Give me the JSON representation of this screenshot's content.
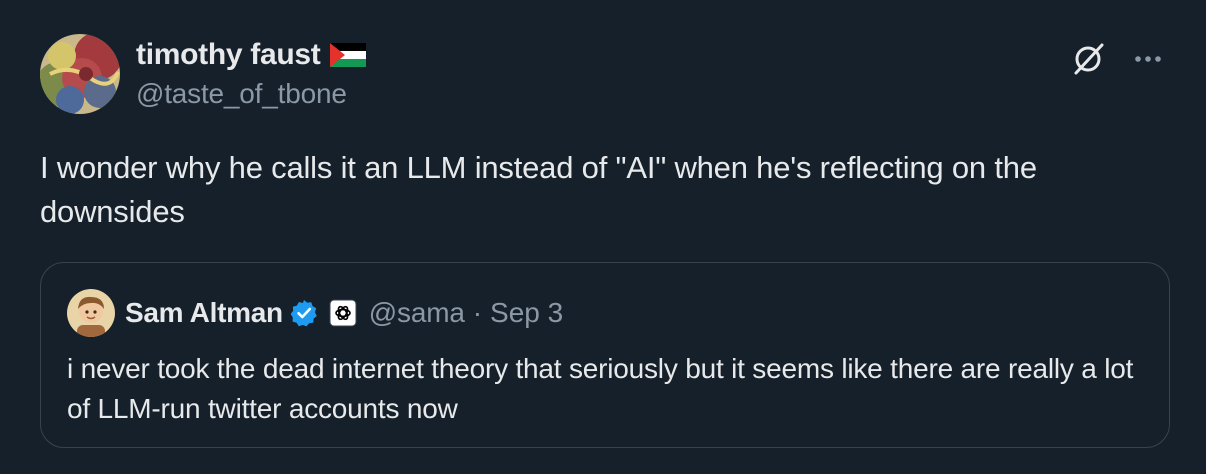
{
  "author": {
    "display_name": "timothy faust",
    "handle": "@taste_of_tbone",
    "flag_icon": "palestine-flag-icon"
  },
  "tweet": {
    "text": "I wonder why he calls it an LLM instead of \"AI\" when he's reflecting on the downsides"
  },
  "toolbar": {
    "grok_icon": "grok-icon",
    "more_icon": "more-options-icon"
  },
  "quoted_tweet": {
    "display_name": "Sam Altman",
    "handle": "@sama",
    "separator": "·",
    "date": "Sep 3",
    "text": "i never took the dead internet theory that seriously but it seems like there are really a lot of LLM-run twitter accounts now",
    "verified_icon": "verified-badge-icon",
    "org_icon": "openai-logo-icon"
  },
  "colors": {
    "background": "#15202b",
    "text_primary": "#e7e9ea",
    "text_secondary": "#8b98a5",
    "border": "#38444d",
    "verified_blue": "#1d9bf0"
  }
}
